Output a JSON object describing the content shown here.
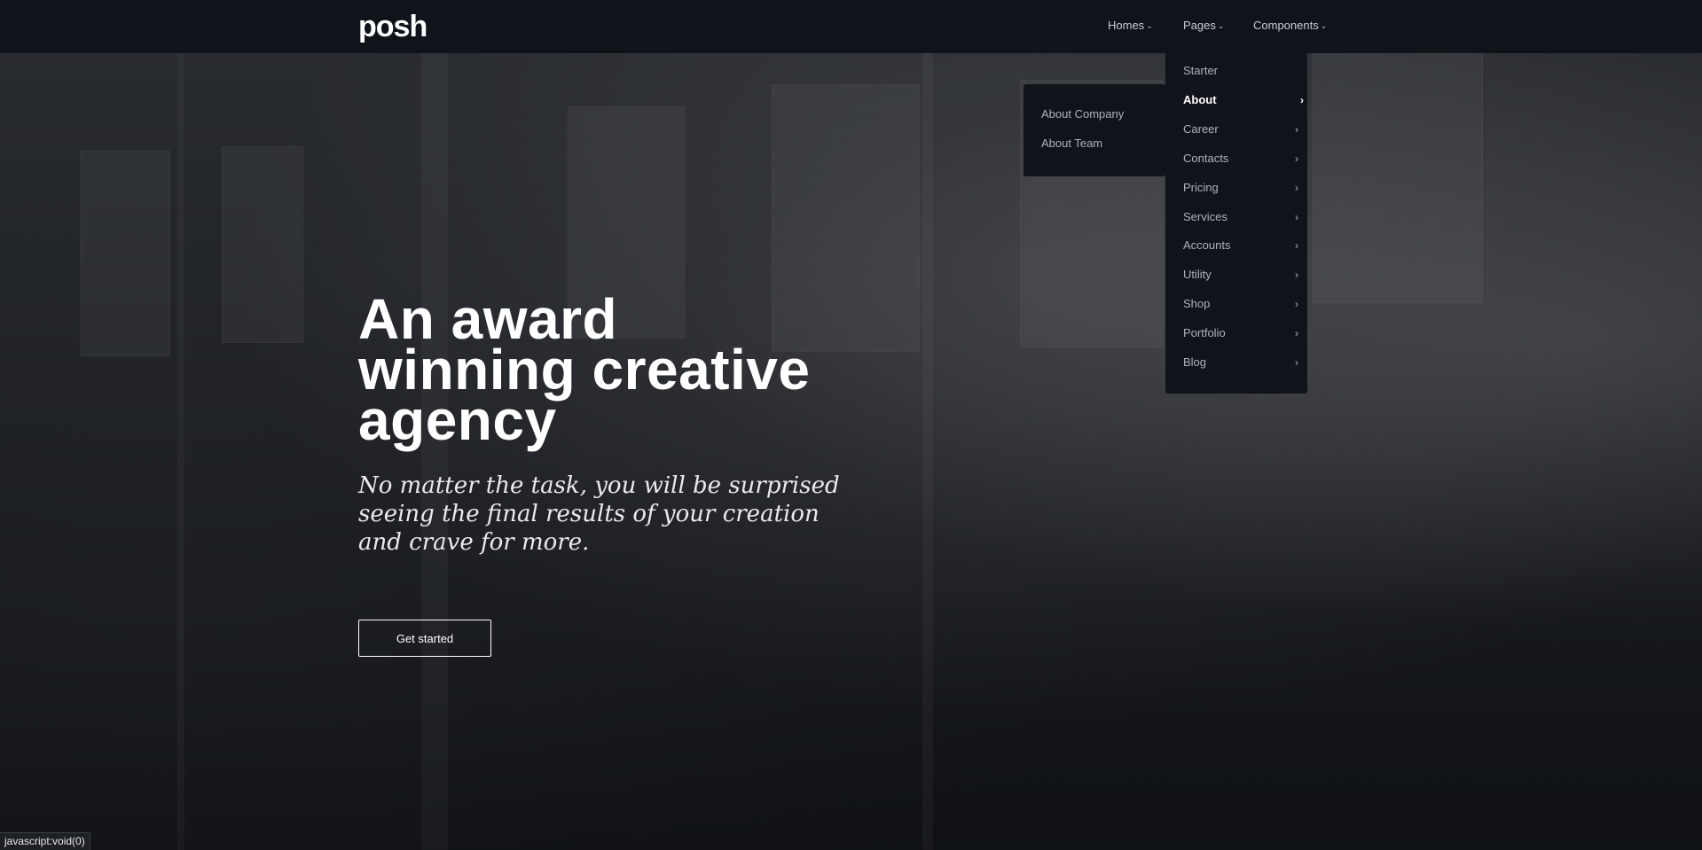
{
  "navbar": {
    "logo": "posh",
    "items": [
      {
        "label": "Homes"
      },
      {
        "label": "Pages"
      },
      {
        "label": "Components"
      }
    ]
  },
  "pages_dropdown": {
    "items": [
      {
        "label": "Starter",
        "has_sub": false
      },
      {
        "label": "About",
        "has_sub": true,
        "active": true
      },
      {
        "label": "Career",
        "has_sub": true
      },
      {
        "label": "Contacts",
        "has_sub": true
      },
      {
        "label": "Pricing",
        "has_sub": true
      },
      {
        "label": "Services",
        "has_sub": true
      },
      {
        "label": "Accounts",
        "has_sub": true
      },
      {
        "label": "Utility",
        "has_sub": true
      },
      {
        "label": "Shop",
        "has_sub": true
      },
      {
        "label": "Portfolio",
        "has_sub": true
      },
      {
        "label": "Blog",
        "has_sub": true
      }
    ]
  },
  "about_submenu": {
    "items": [
      {
        "label": "About Company"
      },
      {
        "label": "About Team"
      }
    ]
  },
  "hero": {
    "headline_lines": [
      "An award",
      "winning creative",
      "agency"
    ],
    "subline_lines": [
      "No matter the task, you will be surprised",
      "seeing the final results of your creation",
      "and crave for more."
    ],
    "cta_label": "Get started"
  },
  "status_bar": {
    "text": "javascript:void(0)"
  }
}
